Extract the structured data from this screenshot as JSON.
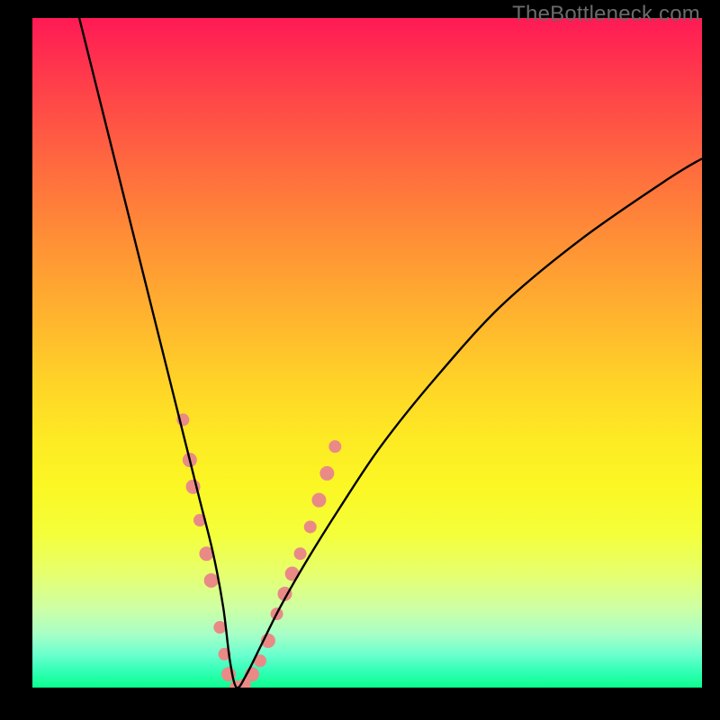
{
  "watermark": "TheBottleneck.com",
  "chart_data": {
    "type": "line",
    "title": "",
    "xlabel": "",
    "ylabel": "",
    "xlim": [
      0,
      100
    ],
    "ylim": [
      0,
      100
    ],
    "grid": false,
    "series": [
      {
        "name": "bottleneck-curve",
        "color": "#000000",
        "x": [
          7,
          9,
          11,
          13,
          15,
          17,
          19,
          21,
          23,
          25,
          27,
          28.5,
          29.5,
          30.5,
          32,
          34,
          37,
          41,
          46,
          52,
          60,
          70,
          82,
          95,
          100
        ],
        "y": [
          100,
          92,
          84,
          76,
          68,
          60,
          52,
          44,
          36,
          28,
          20,
          12,
          4,
          0,
          2,
          6,
          12,
          19,
          27,
          36,
          46,
          57,
          67,
          76,
          79
        ]
      }
    ],
    "markers": {
      "name": "highlight-dots",
      "color": "#e98a87",
      "points": [
        {
          "x": 22.5,
          "y": 40,
          "r": 7
        },
        {
          "x": 23.5,
          "y": 34,
          "r": 8
        },
        {
          "x": 24.0,
          "y": 30,
          "r": 8
        },
        {
          "x": 25.0,
          "y": 25,
          "r": 7
        },
        {
          "x": 26.0,
          "y": 20,
          "r": 8
        },
        {
          "x": 26.7,
          "y": 16,
          "r": 8
        },
        {
          "x": 28.0,
          "y": 9,
          "r": 7
        },
        {
          "x": 28.7,
          "y": 5,
          "r": 7
        },
        {
          "x": 29.3,
          "y": 2,
          "r": 8
        },
        {
          "x": 30.5,
          "y": 0,
          "r": 8
        },
        {
          "x": 31.7,
          "y": 0.5,
          "r": 7
        },
        {
          "x": 32.8,
          "y": 2,
          "r": 8
        },
        {
          "x": 34.0,
          "y": 4,
          "r": 7
        },
        {
          "x": 35.2,
          "y": 7,
          "r": 8
        },
        {
          "x": 36.5,
          "y": 11,
          "r": 7
        },
        {
          "x": 37.7,
          "y": 14,
          "r": 8
        },
        {
          "x": 38.8,
          "y": 17,
          "r": 8
        },
        {
          "x": 40.0,
          "y": 20,
          "r": 7
        },
        {
          "x": 41.5,
          "y": 24,
          "r": 7
        },
        {
          "x": 42.8,
          "y": 28,
          "r": 8
        },
        {
          "x": 44.0,
          "y": 32,
          "r": 8
        },
        {
          "x": 45.2,
          "y": 36,
          "r": 7
        }
      ]
    }
  }
}
